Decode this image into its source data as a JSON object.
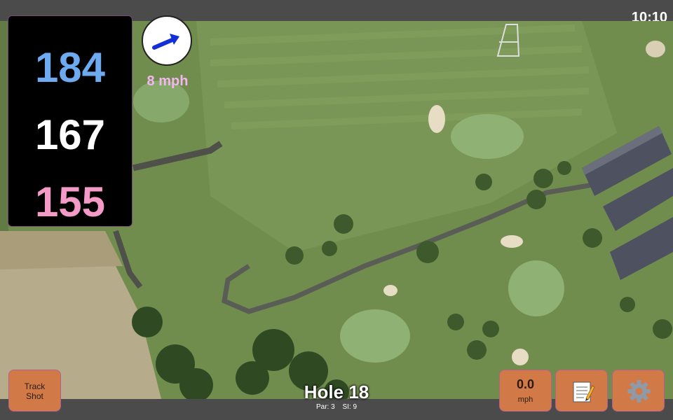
{
  "status": {
    "time": "10:10"
  },
  "yardages": {
    "back": "184",
    "middle": "167",
    "front": "155"
  },
  "wind": {
    "speed_label": "8 mph",
    "icon": "arrow-icon"
  },
  "buttons": {
    "track_shot_line1": "Track",
    "track_shot_line2": "Shot",
    "speed_value": "0.0",
    "speed_unit": "mph",
    "notes_icon": "notepad-icon",
    "settings_icon": "gear-icon"
  },
  "hole": {
    "title": "Hole 18",
    "par": "Par: 3",
    "si": "SI: 9"
  },
  "colors": {
    "back_yardage": "#6eaaf0",
    "middle_yardage": "#ffffff",
    "front_yardage": "#f49ac7",
    "button_bg": "#d17a47"
  }
}
